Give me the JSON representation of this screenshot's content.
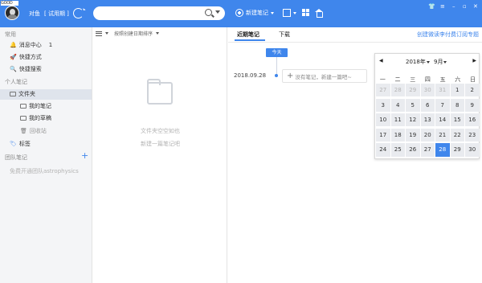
{
  "topbar": {
    "avatar_badge": "GOOD",
    "username": "对鱼",
    "trial_label": "[ 试用期 ]",
    "search_placeholder": "",
    "new_note_label": "新建笔记",
    "window_controls": [
      "shirt-icon",
      "menu-icon",
      "minimize-icon",
      "restore-icon",
      "close-icon"
    ],
    "accent_color": "#3f86ec"
  },
  "sidebar": {
    "common_title": "常用",
    "common_items": [
      {
        "label": "消息中心",
        "badge": "1",
        "icon": "bell-icon"
      },
      {
        "label": "快捷方式",
        "icon": "rocket-icon"
      },
      {
        "label": "快捷搜索",
        "icon": "search-icon"
      }
    ],
    "personal_title": "个人笔记",
    "folder_label": "文件夹",
    "folder_children": [
      {
        "label": "我的笔记",
        "icon": "folder-icon"
      },
      {
        "label": "我的草稿",
        "icon": "folder-icon"
      },
      {
        "label": "回收站",
        "icon": "trash-icon"
      }
    ],
    "tags_label": "标签",
    "team_title": "团队笔记",
    "team_empty": "免费开通团队astrophysics"
  },
  "list": {
    "sort_label": "按照创建日期排序",
    "empty_line1": "文件夹空空如也",
    "empty_line2": "新建一篇笔记吧"
  },
  "main": {
    "tabs": [
      {
        "label": "近期笔记",
        "active": true
      },
      {
        "label": "下载",
        "active": false
      }
    ],
    "right_link": "创建微读李付费订阅专题",
    "today_button": "今天",
    "entry_date": "2018.09.28",
    "no_note_placeholder": "没有笔记，新建一篇吧~"
  },
  "calendar": {
    "prev": "◀",
    "next": "▶",
    "year": "2018年",
    "month": "9月",
    "weekdays": [
      "一",
      "二",
      "三",
      "四",
      "五",
      "六",
      "日"
    ],
    "days": [
      {
        "d": "27",
        "other": true
      },
      {
        "d": "28",
        "other": true
      },
      {
        "d": "29",
        "other": true
      },
      {
        "d": "30",
        "other": true
      },
      {
        "d": "31",
        "other": true
      },
      {
        "d": "1"
      },
      {
        "d": "2"
      },
      {
        "d": "3"
      },
      {
        "d": "4"
      },
      {
        "d": "5"
      },
      {
        "d": "6"
      },
      {
        "d": "7"
      },
      {
        "d": "8"
      },
      {
        "d": "9"
      },
      {
        "d": "10"
      },
      {
        "d": "11"
      },
      {
        "d": "12"
      },
      {
        "d": "13"
      },
      {
        "d": "14"
      },
      {
        "d": "15"
      },
      {
        "d": "16"
      },
      {
        "d": "17"
      },
      {
        "d": "18"
      },
      {
        "d": "19"
      },
      {
        "d": "20"
      },
      {
        "d": "21"
      },
      {
        "d": "22"
      },
      {
        "d": "23"
      },
      {
        "d": "24"
      },
      {
        "d": "25"
      },
      {
        "d": "26"
      },
      {
        "d": "27"
      },
      {
        "d": "28",
        "selected": true
      },
      {
        "d": "29"
      },
      {
        "d": "30"
      }
    ]
  }
}
